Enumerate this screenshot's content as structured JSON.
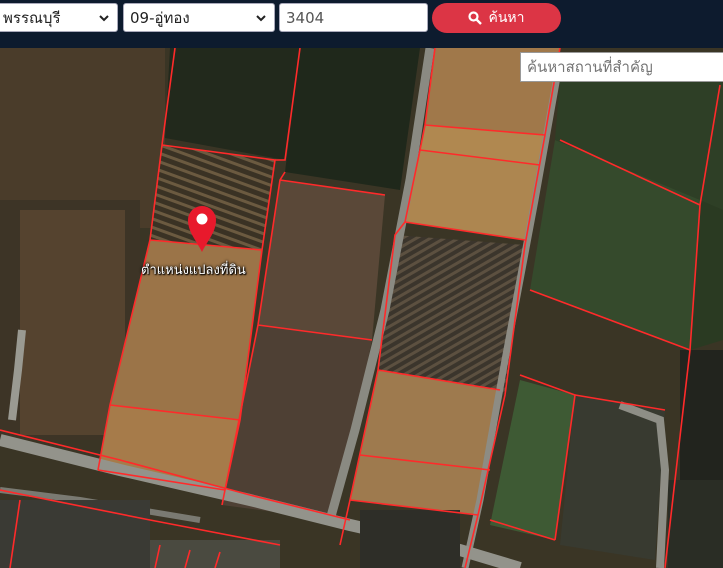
{
  "toolbar": {
    "province_value": "พรรณบุรี",
    "amphoe_value": "09-อู่ทอง",
    "parcel_value": "3404",
    "search_label": "ค้นหา"
  },
  "place_search": {
    "placeholder": "ค้นหาสถานที่สำคัญ"
  },
  "map": {
    "marker_label": "ตำแหน่งแปลงที่ดิน",
    "parcel_line_color": "#ff2a2a",
    "marker_color": "#e8192c"
  }
}
